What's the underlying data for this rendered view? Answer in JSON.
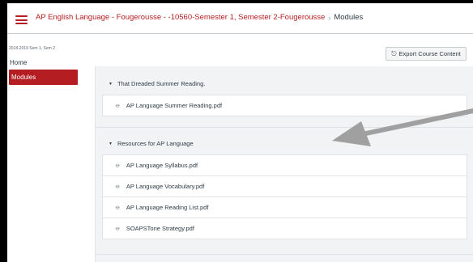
{
  "header": {
    "course_link": "AP English Language - Fougerousse - -10560-Semester 1, Semester 2-Fougerousse",
    "separator": "›",
    "current": "Modules"
  },
  "sidebar": {
    "term": "2018-2019 Sem 1, Sem 2",
    "items": [
      {
        "label": "Home",
        "active": false
      },
      {
        "label": "Modules",
        "active": true
      }
    ]
  },
  "toolbar": {
    "export_label": "Export Course Content",
    "export_icon": "export-icon"
  },
  "modules": [
    {
      "title": "That Dreaded Summer Reading.",
      "items": [
        "AP Language Summer Reading.pdf"
      ]
    },
    {
      "title": "Resources for AP Language",
      "items": [
        "AP Language Syllabus.pdf",
        "AP Language Vocabulary.pdf",
        "AP Language Reading List.pdf",
        "SOAPSTone Strategy.pdf"
      ]
    }
  ],
  "colors": {
    "accent": "#b41e22",
    "text": "#2d3b45",
    "content_bg": "#f2f3f4",
    "arrow": "#a0a0a0"
  }
}
